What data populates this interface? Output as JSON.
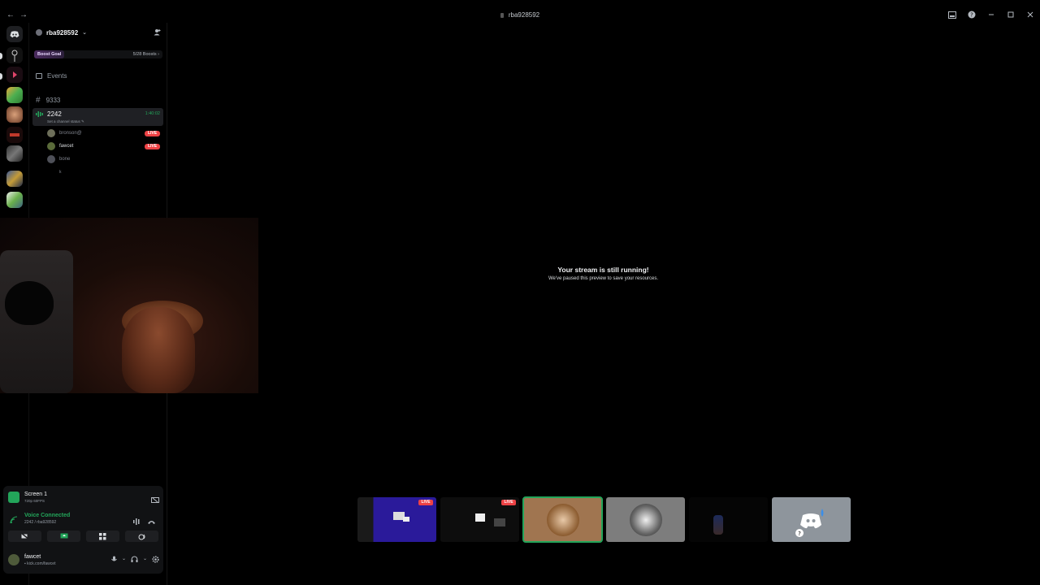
{
  "window": {
    "title": "rba928592",
    "nav_back": "←",
    "nav_forward": "→"
  },
  "guild": {
    "name": "rba928592",
    "boost_goal_label": "Boost Goal",
    "boost_progress": "5/28 Boosts",
    "events_label": "Events",
    "text_channel": "9333",
    "voice_channel": {
      "name": "2242",
      "status_placeholder": "Set a channel status",
      "timer": "1:40:02"
    },
    "members": [
      {
        "name": "bronson@",
        "live": true
      },
      {
        "name": "fawcet",
        "live": true
      },
      {
        "name": "bone",
        "live": false
      }
    ],
    "extra_line": "k",
    "live_label": "LIVE"
  },
  "stream": {
    "paused_title": "Your stream is still running!",
    "paused_sub": "We've paused this preview to save your resources."
  },
  "panel": {
    "screen_name": "Screen 1",
    "screen_quality": "720p 60FPS",
    "voice_connected": "Voice Connected",
    "voice_location": "2242 / rba928592",
    "user_name": "fawcet",
    "user_status": "kick.com/fawcet"
  },
  "colors": {
    "accent_green": "#23a55a",
    "live_red": "#ed4245",
    "boost_purple": "#4a2a5e"
  }
}
